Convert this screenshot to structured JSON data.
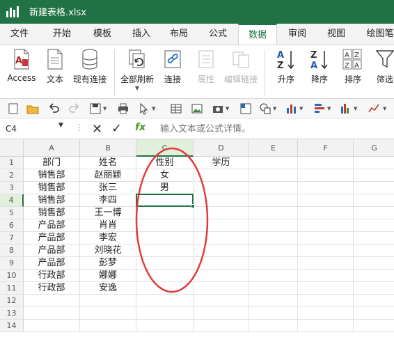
{
  "window": {
    "title": "新建表格.xlsx"
  },
  "tabs": [
    "文件",
    "开始",
    "模板",
    "插入",
    "布局",
    "公式",
    "数据",
    "审阅",
    "视图",
    "绘图笔"
  ],
  "active_tab": "数据",
  "ribbon": {
    "access": "Access",
    "text": "文本",
    "existing_conn": "现有连接",
    "refresh_all": "全部刷新",
    "connections": "连接",
    "properties": "属性",
    "edit_links": "编辑链接",
    "sort_asc": "升序",
    "sort_desc": "降序",
    "sort": "排序",
    "filter": "筛选"
  },
  "formula_bar": {
    "name_box": "C4",
    "fx_label": "fx",
    "placeholder": "输入文本或公式详情。"
  },
  "colors": {
    "accent": "#217346",
    "annotation": "#e03c3c"
  },
  "sheet": {
    "columns": [
      "A",
      "B",
      "C",
      "D",
      "E",
      "F",
      "G"
    ],
    "rows": [
      "1",
      "2",
      "3",
      "4",
      "5",
      "6",
      "7",
      "8",
      "9",
      "10",
      "11",
      "12",
      "13",
      "14"
    ],
    "cells": [
      [
        "部门",
        "姓名",
        "性别",
        "学历",
        "",
        "",
        ""
      ],
      [
        "销售部",
        "赵丽颖",
        "女",
        "",
        "",
        "",
        ""
      ],
      [
        "销售部",
        "张三",
        "男",
        "",
        "",
        "",
        ""
      ],
      [
        "销售部",
        "李四",
        "",
        "",
        "",
        "",
        ""
      ],
      [
        "销售部",
        "王一博",
        "",
        "",
        "",
        "",
        ""
      ],
      [
        "产品部",
        "肖肖",
        "",
        "",
        "",
        "",
        ""
      ],
      [
        "产品部",
        "李宏",
        "",
        "",
        "",
        "",
        ""
      ],
      [
        "产品部",
        "刘晓花",
        "",
        "",
        "",
        "",
        ""
      ],
      [
        "产品部",
        "彭梦",
        "",
        "",
        "",
        "",
        ""
      ],
      [
        "行政部",
        "娜娜",
        "",
        "",
        "",
        "",
        ""
      ],
      [
        "行政部",
        "安逸",
        "",
        "",
        "",
        "",
        ""
      ],
      [
        "",
        "",
        "",
        "",
        "",
        "",
        ""
      ],
      [
        "",
        "",
        "",
        "",
        "",
        "",
        ""
      ],
      [
        "",
        "",
        "",
        "",
        "",
        "",
        ""
      ]
    ],
    "selected_cell": "C4"
  }
}
